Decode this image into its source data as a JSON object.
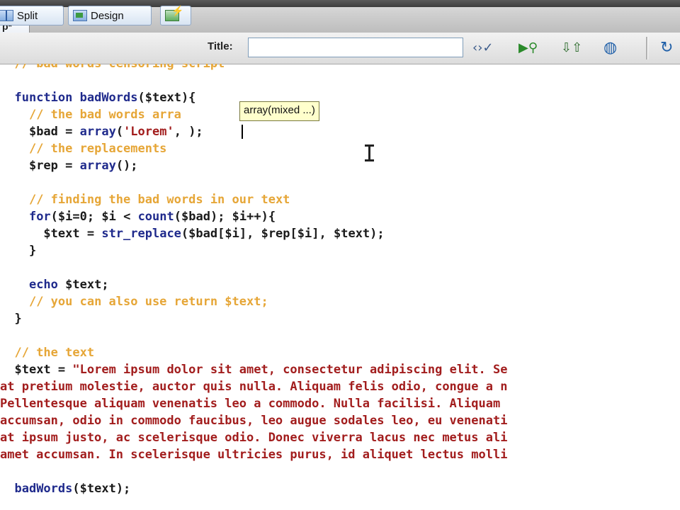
{
  "window": {
    "tab_label": "p*"
  },
  "toolbar": {
    "split_label": "Split",
    "design_label": "Design",
    "title_label": "Title:",
    "title_value": ""
  },
  "code_lines": [
    {
      "indent": "  ",
      "tokens": [
        {
          "t": "cm",
          "v": "// bad words censoring script"
        }
      ]
    },
    {
      "indent": "",
      "tokens": []
    },
    {
      "indent": "  ",
      "tokens": [
        {
          "t": "kw",
          "v": "function "
        },
        {
          "t": "fn",
          "v": "badWords"
        },
        {
          "t": "pn",
          "v": "("
        },
        {
          "t": "var",
          "v": "$text"
        },
        {
          "t": "pn",
          "v": "){"
        }
      ]
    },
    {
      "indent": "    ",
      "tokens": [
        {
          "t": "cm",
          "v": "// the bad words arra"
        }
      ]
    },
    {
      "indent": "    ",
      "tokens": [
        {
          "t": "var",
          "v": "$bad"
        },
        {
          "t": "pn",
          "v": " = "
        },
        {
          "t": "kw",
          "v": "array"
        },
        {
          "t": "pn",
          "v": "("
        },
        {
          "t": "str",
          "v": "'Lorem'"
        },
        {
          "t": "pn",
          "v": ", );"
        }
      ]
    },
    {
      "indent": "    ",
      "tokens": [
        {
          "t": "cm",
          "v": "// the replacements"
        }
      ]
    },
    {
      "indent": "    ",
      "tokens": [
        {
          "t": "var",
          "v": "$rep"
        },
        {
          "t": "pn",
          "v": " = "
        },
        {
          "t": "kw",
          "v": "array"
        },
        {
          "t": "pn",
          "v": "();"
        }
      ]
    },
    {
      "indent": "",
      "tokens": []
    },
    {
      "indent": "    ",
      "tokens": [
        {
          "t": "cm",
          "v": "// finding the bad words in our text"
        }
      ]
    },
    {
      "indent": "    ",
      "tokens": [
        {
          "t": "kw",
          "v": "for"
        },
        {
          "t": "pn",
          "v": "("
        },
        {
          "t": "var",
          "v": "$i"
        },
        {
          "t": "pn",
          "v": "=0; "
        },
        {
          "t": "var",
          "v": "$i"
        },
        {
          "t": "pn",
          "v": " < "
        },
        {
          "t": "kw",
          "v": "count"
        },
        {
          "t": "pn",
          "v": "("
        },
        {
          "t": "var",
          "v": "$bad"
        },
        {
          "t": "pn",
          "v": "); "
        },
        {
          "t": "var",
          "v": "$i"
        },
        {
          "t": "pn",
          "v": "++){"
        }
      ]
    },
    {
      "indent": "      ",
      "tokens": [
        {
          "t": "var",
          "v": "$text"
        },
        {
          "t": "pn",
          "v": " = "
        },
        {
          "t": "kw",
          "v": "str_replace"
        },
        {
          "t": "pn",
          "v": "("
        },
        {
          "t": "var",
          "v": "$bad"
        },
        {
          "t": "pn",
          "v": "["
        },
        {
          "t": "var",
          "v": "$i"
        },
        {
          "t": "pn",
          "v": "], "
        },
        {
          "t": "var",
          "v": "$rep"
        },
        {
          "t": "pn",
          "v": "["
        },
        {
          "t": "var",
          "v": "$i"
        },
        {
          "t": "pn",
          "v": "], "
        },
        {
          "t": "var",
          "v": "$text"
        },
        {
          "t": "pn",
          "v": ");"
        }
      ]
    },
    {
      "indent": "    ",
      "tokens": [
        {
          "t": "pn",
          "v": "}"
        }
      ]
    },
    {
      "indent": "",
      "tokens": []
    },
    {
      "indent": "    ",
      "tokens": [
        {
          "t": "kw",
          "v": "echo "
        },
        {
          "t": "var",
          "v": "$text"
        },
        {
          "t": "pn",
          "v": ";"
        }
      ]
    },
    {
      "indent": "    ",
      "tokens": [
        {
          "t": "cm",
          "v": "// you can also use return $text;"
        }
      ]
    },
    {
      "indent": "  ",
      "tokens": [
        {
          "t": "pn",
          "v": "}"
        }
      ]
    },
    {
      "indent": "",
      "tokens": []
    },
    {
      "indent": "  ",
      "tokens": [
        {
          "t": "cm",
          "v": "// the text"
        }
      ]
    },
    {
      "indent": "  ",
      "tokens": [
        {
          "t": "var",
          "v": "$text"
        },
        {
          "t": "pn",
          "v": " = "
        },
        {
          "t": "str",
          "v": "\"Lorem ipsum dolor sit amet, consectetur adipiscing elit. Se"
        }
      ]
    },
    {
      "indent": "",
      "tokens": [
        {
          "t": "str",
          "v": "at pretium molestie, auctor quis nulla. Aliquam felis odio, congue a n"
        }
      ]
    },
    {
      "indent": "",
      "tokens": [
        {
          "t": "str",
          "v": "Pellentesque aliquam venenatis leo a commodo. Nulla facilisi. Aliquam"
        }
      ]
    },
    {
      "indent": "",
      "tokens": [
        {
          "t": "str",
          "v": "accumsan, odio in commodo faucibus, leo augue sodales leo, eu venenati"
        }
      ]
    },
    {
      "indent": "",
      "tokens": [
        {
          "t": "str",
          "v": "at ipsum justo, ac scelerisque odio. Donec viverra lacus nec metus ali"
        }
      ]
    },
    {
      "indent": "",
      "tokens": [
        {
          "t": "str",
          "v": "amet accumsan. In scelerisque ultricies purus, id aliquet lectus molli"
        }
      ]
    },
    {
      "indent": "",
      "tokens": []
    },
    {
      "indent": "  ",
      "tokens": [
        {
          "t": "fn",
          "v": "badWords"
        },
        {
          "t": "pn",
          "v": "("
        },
        {
          "t": "var",
          "v": "$text"
        },
        {
          "t": "pn",
          "v": ");"
        }
      ]
    }
  ],
  "code_hint": {
    "text": "array(mixed ...)"
  },
  "icons": {
    "split": "split-view-icon",
    "design": "design-view-icon",
    "live": "live-view-icon",
    "validate": "validate-markup-icon",
    "preview": "preview-debug-icon",
    "file_management": "file-management-icon",
    "browser": "browser-check-icon",
    "refresh": "refresh-icon"
  }
}
